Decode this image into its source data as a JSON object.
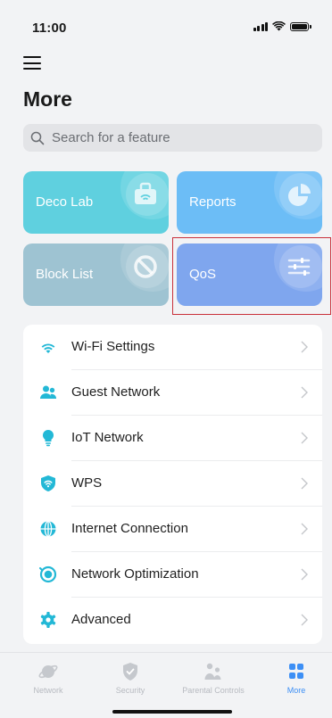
{
  "status": {
    "time": "11:00"
  },
  "header": {
    "title": "More"
  },
  "search": {
    "placeholder": "Search for a feature",
    "value": ""
  },
  "tiles": [
    {
      "label": "Deco Lab",
      "color": "#5fd0df",
      "icon": "toolbox-icon"
    },
    {
      "label": "Reports",
      "color": "#6cbdf6",
      "icon": "pie-chart-icon"
    },
    {
      "label": "Block List",
      "color": "#9ec3d2",
      "icon": "block-icon"
    },
    {
      "label": "QoS",
      "color": "#7fa6ee",
      "icon": "sliders-icon"
    }
  ],
  "menu": {
    "items": [
      {
        "label": "Wi-Fi Settings",
        "icon": "wifi-icon"
      },
      {
        "label": "Guest Network",
        "icon": "guest-users-icon"
      },
      {
        "label": "IoT Network",
        "icon": "lightbulb-icon"
      },
      {
        "label": "WPS",
        "icon": "wps-shield-icon"
      },
      {
        "label": "Internet Connection",
        "icon": "globe-icon"
      },
      {
        "label": "Network Optimization",
        "icon": "optimization-icon"
      },
      {
        "label": "Advanced",
        "icon": "gear-icon"
      }
    ]
  },
  "tabbar": {
    "tabs": [
      {
        "label": "Network",
        "icon": "planet-icon"
      },
      {
        "label": "Security",
        "icon": "shield-icon"
      },
      {
        "label": "Parental Controls",
        "icon": "family-icon"
      },
      {
        "label": "More",
        "icon": "grid-icon",
        "active": true
      }
    ]
  },
  "colors": {
    "accent": "#23b8d6",
    "active_tab": "#3d8ff5",
    "highlight": "#c9303a"
  }
}
